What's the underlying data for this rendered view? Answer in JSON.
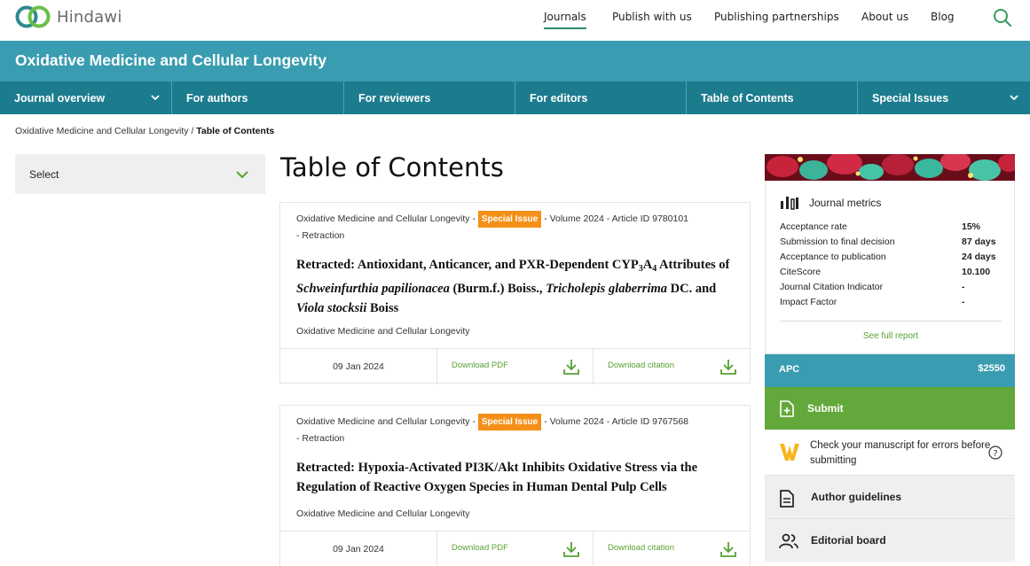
{
  "brand": {
    "name": "Hindawi"
  },
  "topnav": {
    "items": [
      {
        "label": "Journals"
      },
      {
        "label": "Publish with us"
      },
      {
        "label": "Publishing partnerships"
      },
      {
        "label": "About us"
      },
      {
        "label": "Blog"
      }
    ]
  },
  "journal_title": "Oxidative Medicine and Cellular Longevity",
  "secondary_nav": [
    {
      "label": "Journal overview"
    },
    {
      "label": "For authors"
    },
    {
      "label": "For reviewers"
    },
    {
      "label": "For editors"
    },
    {
      "label": "Table of Contents"
    },
    {
      "label": "Special Issues"
    }
  ],
  "breadcrumb": {
    "parent": "Oxidative Medicine and Cellular Longevity",
    "separator": " / ",
    "current": "Table of Contents"
  },
  "filter": {
    "label": "Select"
  },
  "page_title": "Table of Contents",
  "articles": [
    {
      "meta_prefix": "Oxidative Medicine and Cellular Longevity - ",
      "badge": "Special Issue",
      "meta_suffix": " - Volume 2024 - Article ID 9780101",
      "meta_type": "- Retraction",
      "title_parts": [
        "Retracted: Antioxidant, Anticancer, and PXR-Dependent CYP",
        "3",
        "A",
        "4",
        " Attributes of ",
        "Schweinfurthia papilionacea",
        " (Burm.f.) Boiss., ",
        "Tricholepis glaberrima",
        " DC. and ",
        "Viola stocksii",
        " Boiss"
      ],
      "journal": "Oxidative Medicine and Cellular Longevity",
      "date": "09 Jan 2024",
      "pdf_label": "Download PDF",
      "citation_label": "Download citation"
    },
    {
      "meta_prefix": "Oxidative Medicine and Cellular Longevity - ",
      "badge": "Special Issue",
      "meta_suffix": " - Volume 2024 - Article ID 9767568",
      "meta_type": "- Retraction",
      "title": "Retracted: Hypoxia-Activated PI3K/Akt Inhibits Oxidative Stress via the Regulation of Reactive Oxygen Species in Human Dental Pulp Cells",
      "journal": "Oxidative Medicine and Cellular Longevity",
      "date": "09 Jan 2024",
      "pdf_label": "Download PDF",
      "citation_label": "Download citation"
    }
  ],
  "metrics": {
    "heading": "Journal metrics",
    "rows": [
      {
        "label": "Acceptance rate",
        "value": "15%"
      },
      {
        "label": "Submission to final decision",
        "value": "87 days"
      },
      {
        "label": "Acceptance to publication",
        "value": "24 days"
      },
      {
        "label": "CiteScore",
        "value": "10.100"
      },
      {
        "label": "Journal Citation Indicator",
        "value": "-"
      },
      {
        "label": "Impact Factor",
        "value": "-"
      }
    ],
    "see_full": "See full report"
  },
  "apc": {
    "label": "APC",
    "value": "$2550"
  },
  "submit": {
    "label": "Submit"
  },
  "check": {
    "label": "Check your manuscript for errors before submitting"
  },
  "side_links": [
    {
      "label": "Author guidelines"
    },
    {
      "label": "Editorial board"
    }
  ],
  "colors": {
    "teal": "#3a9cb0",
    "dark_teal": "#1c7c8e",
    "green": "#63a83a",
    "orange": "#f49018",
    "link_green": "#58a033"
  }
}
